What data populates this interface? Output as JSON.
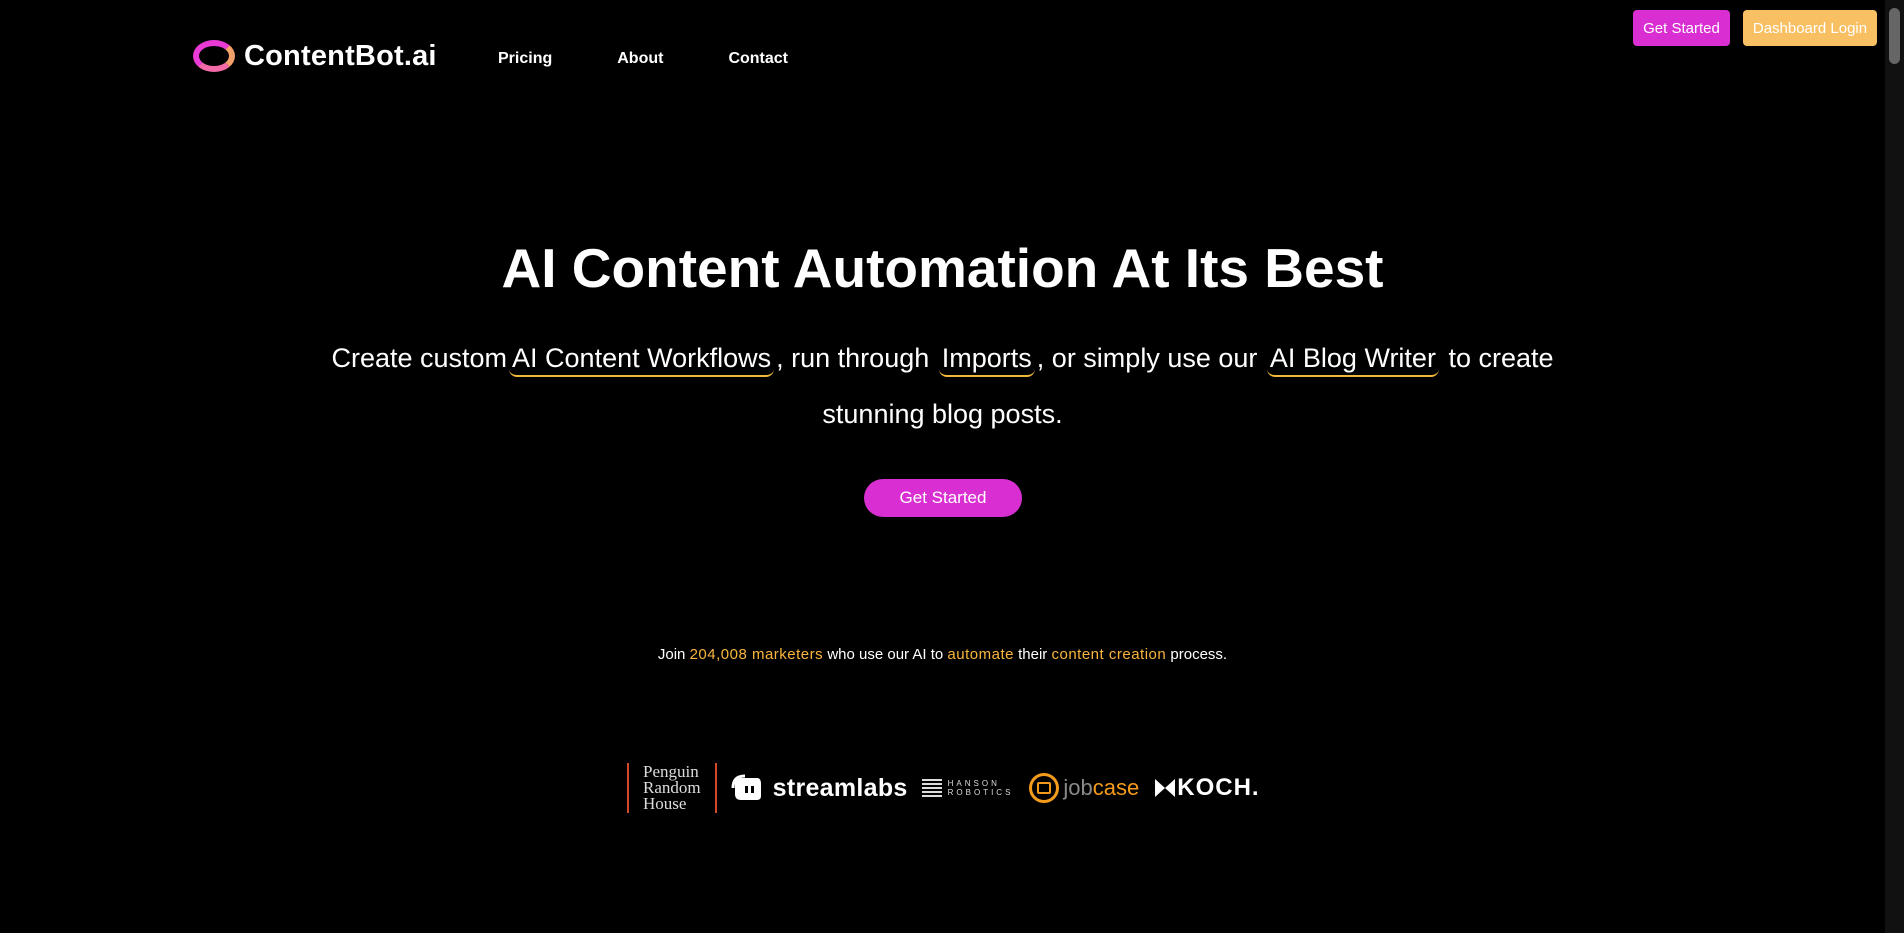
{
  "header": {
    "logo_text": "ContentBot.ai",
    "nav": [
      "Pricing",
      "About",
      "Contact"
    ],
    "get_started": "Get Started",
    "dashboard_login": "Dashboard Login"
  },
  "hero": {
    "title": "AI Content Automation At Its Best",
    "sub_1": "Create custom",
    "link_workflows": "AI Content Workflows",
    "sub_2": ", run through",
    "link_imports": "Imports",
    "sub_3": ", or simply use our",
    "link_blog_writer": "AI Blog Writer",
    "sub_4": "to create stunning blog posts.",
    "cta": "Get Started"
  },
  "stats": {
    "p1": "Join",
    "count": "204,008 marketers",
    "p2": "who use our AI to",
    "automate": "automate",
    "p3": "their",
    "content_creation": "content creation",
    "p4": "process."
  },
  "logos": {
    "penguin": [
      "Penguin",
      "Random",
      "House"
    ],
    "streamlabs": "streamlabs",
    "hanson": [
      "HANSON",
      "ROBOTICS"
    ],
    "jobcase_job": "job",
    "jobcase_case": "case",
    "koch": "KOCH."
  },
  "colors": {
    "accent": "#f9b53d",
    "primary": "#d92fd2",
    "secondary": "#f9c063"
  }
}
